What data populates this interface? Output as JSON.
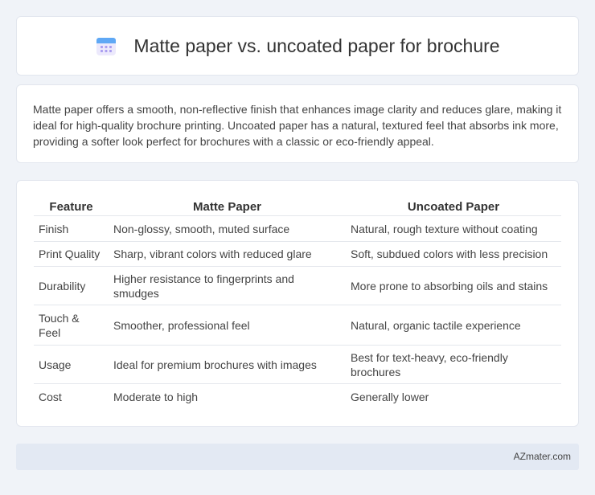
{
  "header": {
    "title": "Matte paper vs. uncoated paper for brochure",
    "icon": "calendar-icon"
  },
  "intro": {
    "text": "Matte paper offers a smooth, non-reflective finish that enhances image clarity and reduces glare, making it ideal for high-quality brochure printing. Uncoated paper has a natural, textured feel that absorbs ink more, providing a softer look perfect for brochures with a classic or eco-friendly appeal."
  },
  "table": {
    "headers": [
      "Feature",
      "Matte Paper",
      "Uncoated Paper"
    ],
    "rows": [
      [
        "Finish",
        "Non-glossy, smooth, muted surface",
        "Natural, rough texture without coating"
      ],
      [
        "Print Quality",
        "Sharp, vibrant colors with reduced glare",
        "Soft, subdued colors with less precision"
      ],
      [
        "Durability",
        "Higher resistance to fingerprints and smudges",
        "More prone to absorbing oils and stains"
      ],
      [
        "Touch & Feel",
        "Smoother, professional feel",
        "Natural, organic tactile experience"
      ],
      [
        "Usage",
        "Ideal for premium brochures with images",
        "Best for text-heavy, eco-friendly brochures"
      ],
      [
        "Cost",
        "Moderate to high",
        "Generally lower"
      ]
    ]
  },
  "footer": {
    "brand": "AZmater.com"
  },
  "colors": {
    "background": "#f0f3f8",
    "icon_primary": "#8b7fe6",
    "icon_secondary": "#5fa8f5",
    "footer": "#e3e9f3"
  }
}
